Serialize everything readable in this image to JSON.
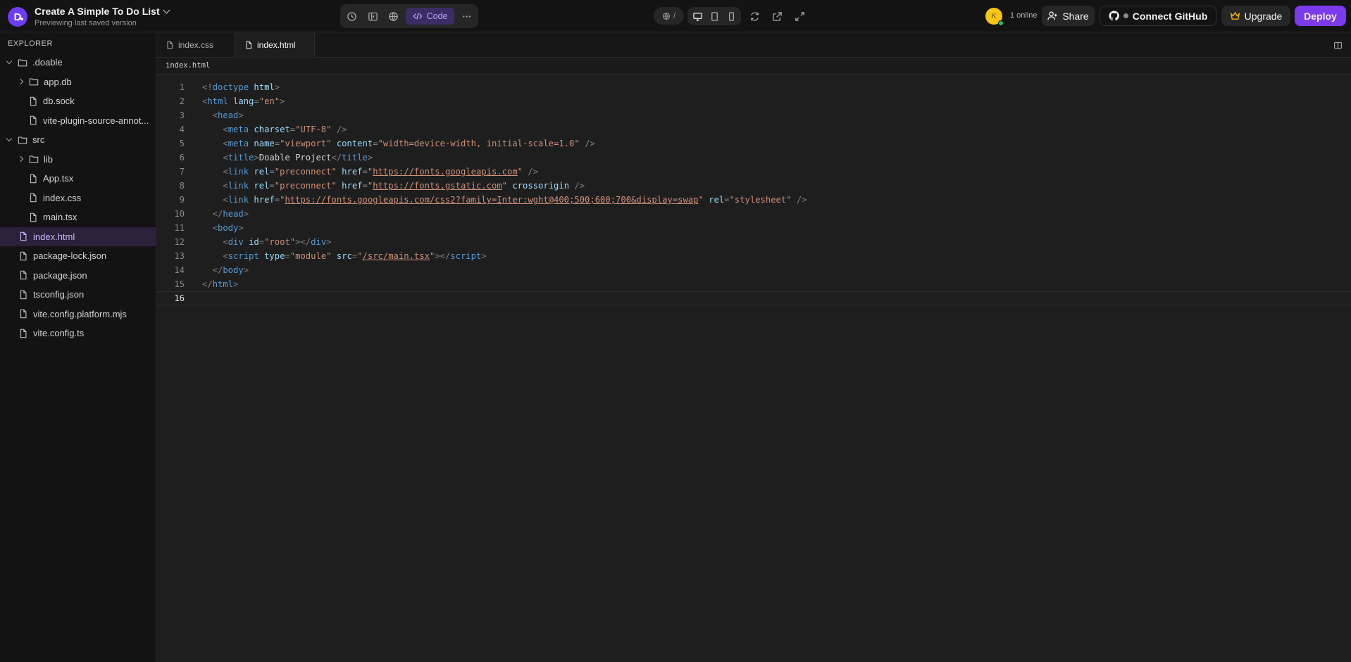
{
  "header": {
    "logo_letter": "D",
    "project_title": "Create A Simple To Do List",
    "subtitle": "Previewing last saved version",
    "toolbar_icons": [
      "history-icon",
      "sidebar-icon",
      "globe-icon",
      "code-icon",
      "more-icon"
    ],
    "code_label": "Code",
    "url_path": "/",
    "avatar_letter": "K",
    "online_text": "1 online",
    "share_label": "Share",
    "github_label": "Connect GitHub",
    "upgrade_label": "Upgrade",
    "deploy_label": "Deploy",
    "colors": {
      "accent": "#7c3aed",
      "code_active": "#b9a3ff",
      "online": "#22c55e",
      "avatar": "#f5c518"
    }
  },
  "explorer": {
    "title": "EXPLORER",
    "items": [
      {
        "label": ".doable",
        "type": "folder",
        "expanded": true
      },
      {
        "label": "app.db",
        "type": "folder",
        "expanded": false
      },
      {
        "label": "db.sock",
        "type": "file"
      },
      {
        "label": "vite-plugin-source-annot...",
        "type": "file"
      },
      {
        "label": "src",
        "type": "folder",
        "expanded": true
      },
      {
        "label": "lib",
        "type": "folder",
        "expanded": false
      },
      {
        "label": "App.tsx",
        "type": "file"
      },
      {
        "label": "index.css",
        "type": "file"
      },
      {
        "label": "main.tsx",
        "type": "file"
      },
      {
        "label": "index.html",
        "type": "file",
        "active": true
      },
      {
        "label": "package-lock.json",
        "type": "file"
      },
      {
        "label": "package.json",
        "type": "file"
      },
      {
        "label": "tsconfig.json",
        "type": "file"
      },
      {
        "label": "vite.config.platform.mjs",
        "type": "file"
      },
      {
        "label": "vite.config.ts",
        "type": "file"
      }
    ]
  },
  "editor": {
    "tabs": [
      {
        "label": "index.css",
        "active": false
      },
      {
        "label": "index.html",
        "active": true
      }
    ],
    "breadcrumb": "index.html",
    "current_line": 16,
    "lines": [
      "1",
      "2",
      "3",
      "4",
      "5",
      "6",
      "7",
      "8",
      "9",
      "10",
      "11",
      "12",
      "13",
      "14",
      "15",
      "16"
    ],
    "code": {
      "doctype": "doctype",
      "html": "html",
      "lang": "lang",
      "en": "\"en\"",
      "head": "head",
      "meta": "meta",
      "charset": "charset",
      "utf8": "\"UTF-8\"",
      "name": "name",
      "viewport": "\"viewport\"",
      "content": "content",
      "viewport_content": "\"width=device-width, initial-scale=1.0\"",
      "title": "title",
      "title_text": "Doable Project",
      "link": "link",
      "rel": "rel",
      "preconnect": "\"preconnect\"",
      "href": "href",
      "url_googleapis": "https://fonts.googleapis.com",
      "url_gstatic": "https://fonts.gstatic.com",
      "crossorigin": "crossorigin",
      "url_css2": "https://fonts.googleapis.com/css2?family=Inter:wght@400;500;600;700&display=swap",
      "stylesheet": "\"stylesheet\"",
      "body": "body",
      "div": "div",
      "id": "id",
      "root": "\"root\"",
      "script": "script",
      "type": "type",
      "module": "\"module\"",
      "src": "src",
      "main_src": "/src/main.tsx"
    }
  }
}
